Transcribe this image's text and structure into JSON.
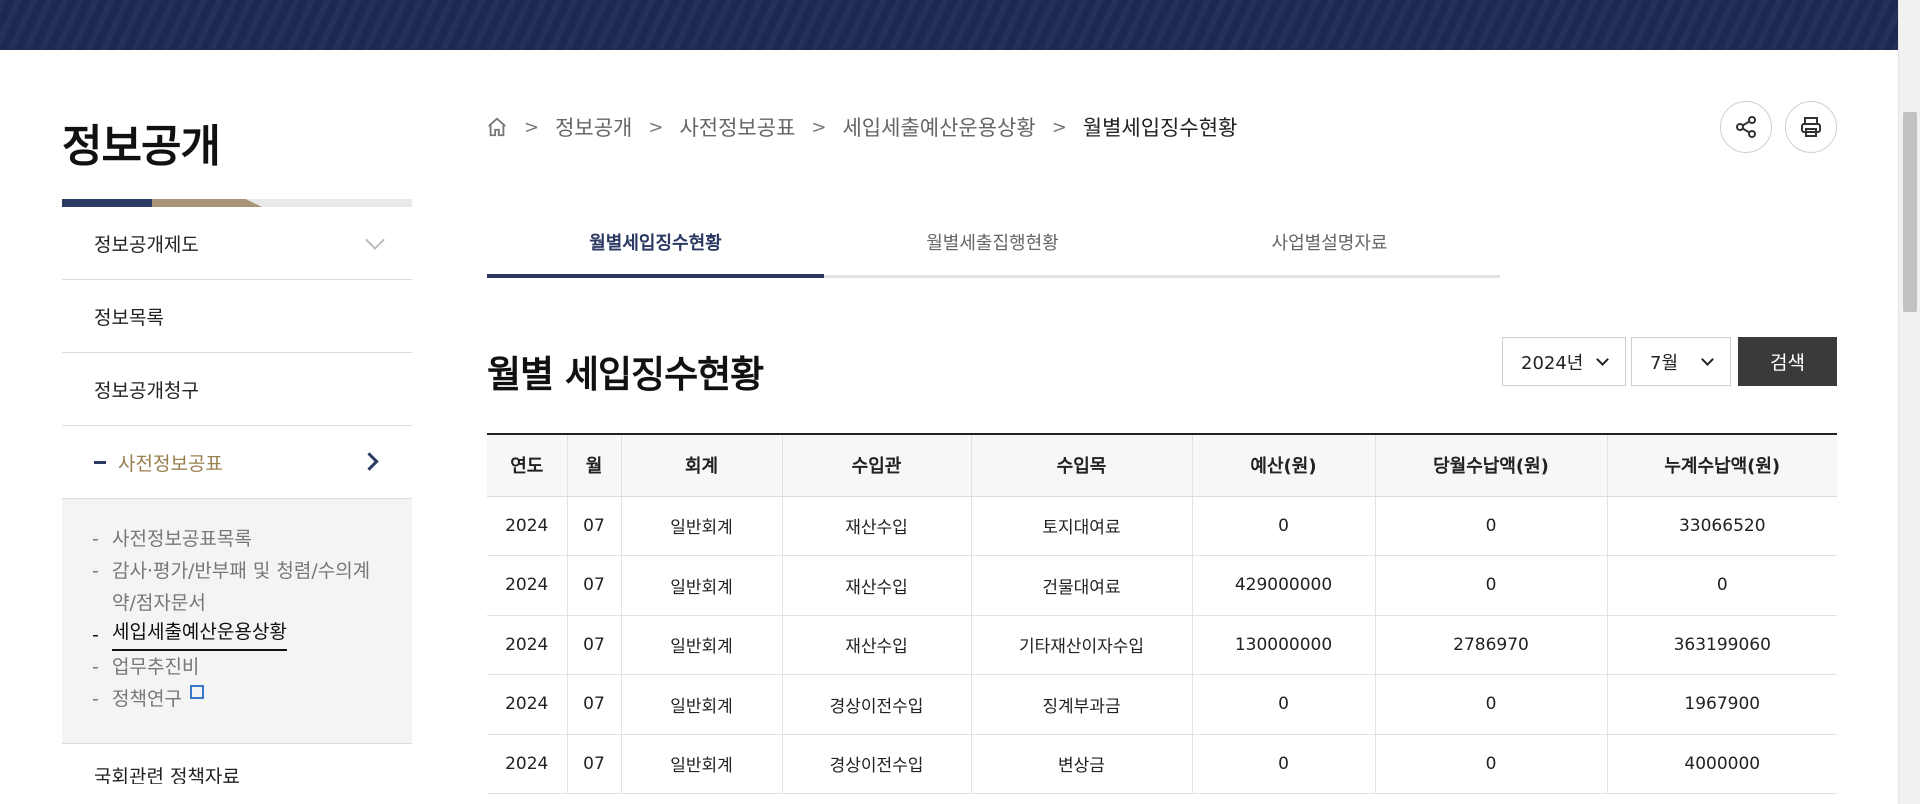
{
  "sidebar": {
    "title": "정보공개",
    "items": [
      {
        "label": "정보공개제도"
      },
      {
        "label": "정보목록"
      },
      {
        "label": "정보공개청구"
      },
      {
        "label": "사전정보공표"
      }
    ],
    "sub_items": [
      {
        "label": "사전정보공표목록"
      },
      {
        "label": "감사·평가/반부패 및 청렴/수의계약/점자문서"
      },
      {
        "label": "세입세출예산운용상황"
      },
      {
        "label": "업무추진비"
      },
      {
        "label": "정책연구"
      }
    ],
    "cut_item": "국회관련 정책자료"
  },
  "breadcrumb": [
    "정보공개",
    "사전정보공표",
    "세입세출예산운용상황",
    "월별세입징수현황"
  ],
  "tabs": [
    {
      "label": "월별세입징수현황"
    },
    {
      "label": "월별세출집행현황"
    },
    {
      "label": "사업별설명자료"
    }
  ],
  "page_title": "월별 세입징수현황",
  "filters": {
    "year": "2024년",
    "month": "7월",
    "search_label": "검색"
  },
  "table": {
    "headers": [
      "연도",
      "월",
      "회계",
      "수입관",
      "수입목",
      "예산(원)",
      "당월수납액(원)",
      "누계수납액(원)"
    ],
    "rows": [
      [
        "2024",
        "07",
        "일반회계",
        "재산수입",
        "토지대여료",
        "0",
        "0",
        "33066520"
      ],
      [
        "2024",
        "07",
        "일반회계",
        "재산수입",
        "건물대여료",
        "429000000",
        "0",
        "0"
      ],
      [
        "2024",
        "07",
        "일반회계",
        "재산수입",
        "기타재산이자수입",
        "130000000",
        "2786970",
        "363199060"
      ],
      [
        "2024",
        "07",
        "일반회계",
        "경상이전수입",
        "징계부과금",
        "0",
        "0",
        "1967900"
      ],
      [
        "2024",
        "07",
        "일반회계",
        "경상이전수입",
        "변상금",
        "0",
        "0",
        "4000000"
      ]
    ]
  }
}
